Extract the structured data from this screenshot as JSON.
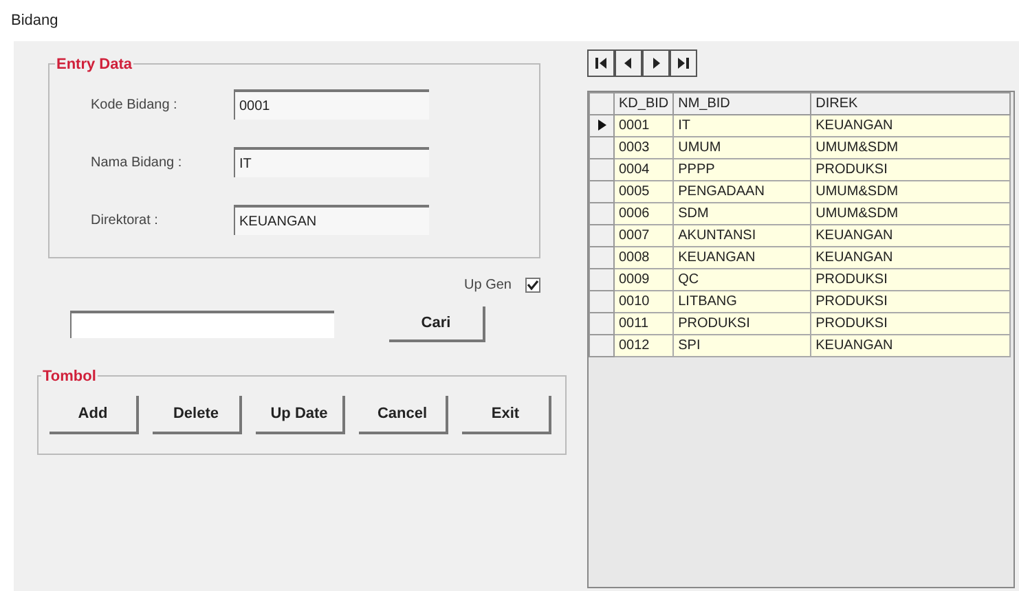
{
  "window": {
    "title": "Bidang"
  },
  "entry_group": {
    "title": "Entry Data",
    "fields": [
      {
        "label": "Kode Bidang :",
        "value": "0001"
      },
      {
        "label": "Nama Bidang :",
        "value": "IT"
      },
      {
        "label": "Direktorat :",
        "value": "KEUANGAN"
      }
    ]
  },
  "up_gen": {
    "label": "Up Gen",
    "checked": true
  },
  "search": {
    "button": "Cari"
  },
  "button_group": {
    "title": "Tombol",
    "buttons": [
      "Add",
      "Delete",
      "Up Date",
      "Cancel",
      "Exit"
    ]
  },
  "navigator": [
    {
      "kind": "first"
    },
    {
      "kind": "prev"
    },
    {
      "kind": "next"
    },
    {
      "kind": "last"
    }
  ],
  "table": {
    "columns": [
      "KD_BID",
      "NM_BID",
      "DIREK"
    ],
    "rows": [
      {
        "cells": [
          "0001",
          "IT",
          "KEUANGAN"
        ],
        "selected": true
      },
      {
        "cells": [
          "0003",
          "UMUM",
          "UMUM&SDM"
        ],
        "selected": false
      },
      {
        "cells": [
          "0004",
          "PPPP",
          "PRODUKSI"
        ],
        "selected": false
      },
      {
        "cells": [
          "0005",
          "PENGADAAN",
          "UMUM&SDM"
        ],
        "selected": false
      },
      {
        "cells": [
          "0006",
          "SDM",
          "UMUM&SDM"
        ],
        "selected": false
      },
      {
        "cells": [
          "0007",
          "AKUNTANSI",
          "KEUANGAN"
        ],
        "selected": false
      },
      {
        "cells": [
          "0008",
          "KEUANGAN",
          "KEUANGAN"
        ],
        "selected": false
      },
      {
        "cells": [
          "0009",
          "QC",
          "PRODUKSI"
        ],
        "selected": false
      },
      {
        "cells": [
          "0010",
          "LITBANG",
          "PRODUKSI"
        ],
        "selected": false
      },
      {
        "cells": [
          "0011",
          "PRODUKSI",
          "PRODUKSI"
        ],
        "selected": false
      },
      {
        "cells": [
          "0012",
          "SPI",
          "KEUANGAN"
        ],
        "selected": false
      }
    ]
  }
}
